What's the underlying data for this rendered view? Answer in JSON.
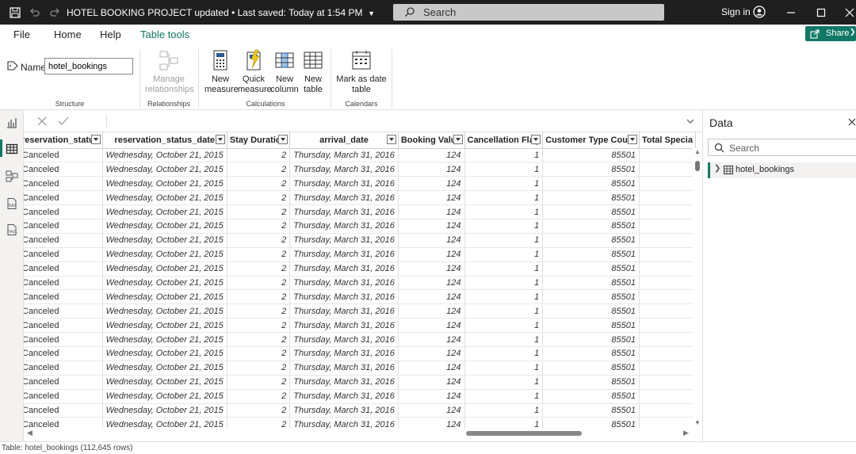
{
  "titlebar": {
    "title": "HOTEL BOOKING PROJECT updated • Last saved: Today at 1:54 PM",
    "search_placeholder": "Search",
    "sign_in": "Sign in"
  },
  "ribbon": {
    "tabs": [
      {
        "label": "File"
      },
      {
        "label": "Home"
      },
      {
        "label": "Help"
      },
      {
        "label": "Table tools",
        "active": true
      }
    ],
    "share": "Share",
    "name_label": "Name",
    "name_value": "hotel_bookings",
    "buttons": {
      "manage_relationships": "Manage relationships",
      "new_measure": "New measure",
      "quick_measure": "Quick measure",
      "new_column": "New column",
      "new_table": "New table",
      "mark_as_date_table": "Mark as date table"
    },
    "groups": {
      "structure": "Structure",
      "relationships": "Relationships",
      "calculations": "Calculations",
      "calendars": "Calendars"
    }
  },
  "table": {
    "columns": [
      "reservation_status",
      "reservation_status_date",
      "Stay Duration",
      "arrival_date",
      "Booking Value",
      "Cancellation Flag",
      "Customer Type Count",
      "Total Specia"
    ],
    "rows": [
      [
        "Canceled",
        "Wednesday, October 21, 2015",
        "2",
        "Thursday, March 31, 2016",
        "124",
        "1",
        "85501",
        ""
      ],
      [
        "Canceled",
        "Wednesday, October 21, 2015",
        "2",
        "Thursday, March 31, 2016",
        "124",
        "1",
        "85501",
        ""
      ],
      [
        "Canceled",
        "Wednesday, October 21, 2015",
        "2",
        "Thursday, March 31, 2016",
        "124",
        "1",
        "85501",
        ""
      ],
      [
        "Canceled",
        "Wednesday, October 21, 2015",
        "2",
        "Thursday, March 31, 2016",
        "124",
        "1",
        "85501",
        ""
      ],
      [
        "Canceled",
        "Wednesday, October 21, 2015",
        "2",
        "Thursday, March 31, 2016",
        "124",
        "1",
        "85501",
        ""
      ],
      [
        "Canceled",
        "Wednesday, October 21, 2015",
        "2",
        "Thursday, March 31, 2016",
        "124",
        "1",
        "85501",
        ""
      ],
      [
        "Canceled",
        "Wednesday, October 21, 2015",
        "2",
        "Thursday, March 31, 2016",
        "124",
        "1",
        "85501",
        ""
      ],
      [
        "Canceled",
        "Wednesday, October 21, 2015",
        "2",
        "Thursday, March 31, 2016",
        "124",
        "1",
        "85501",
        ""
      ],
      [
        "Canceled",
        "Wednesday, October 21, 2015",
        "2",
        "Thursday, March 31, 2016",
        "124",
        "1",
        "85501",
        ""
      ],
      [
        "Canceled",
        "Wednesday, October 21, 2015",
        "2",
        "Thursday, March 31, 2016",
        "124",
        "1",
        "85501",
        ""
      ],
      [
        "Canceled",
        "Wednesday, October 21, 2015",
        "2",
        "Thursday, March 31, 2016",
        "124",
        "1",
        "85501",
        ""
      ],
      [
        "Canceled",
        "Wednesday, October 21, 2015",
        "2",
        "Thursday, March 31, 2016",
        "124",
        "1",
        "85501",
        ""
      ],
      [
        "Canceled",
        "Wednesday, October 21, 2015",
        "2",
        "Thursday, March 31, 2016",
        "124",
        "1",
        "85501",
        ""
      ],
      [
        "Canceled",
        "Wednesday, October 21, 2015",
        "2",
        "Thursday, March 31, 2016",
        "124",
        "1",
        "85501",
        ""
      ],
      [
        "Canceled",
        "Wednesday, October 21, 2015",
        "2",
        "Thursday, March 31, 2016",
        "124",
        "1",
        "85501",
        ""
      ],
      [
        "Canceled",
        "Wednesday, October 21, 2015",
        "2",
        "Thursday, March 31, 2016",
        "124",
        "1",
        "85501",
        ""
      ],
      [
        "Canceled",
        "Wednesday, October 21, 2015",
        "2",
        "Thursday, March 31, 2016",
        "124",
        "1",
        "85501",
        ""
      ],
      [
        "Canceled",
        "Wednesday, October 21, 2015",
        "2",
        "Thursday, March 31, 2016",
        "124",
        "1",
        "85501",
        ""
      ],
      [
        "Canceled",
        "Wednesday, October 21, 2015",
        "2",
        "Thursday, March 31, 2016",
        "124",
        "1",
        "85501",
        ""
      ],
      [
        "Canceled",
        "Wednesday, October 21, 2015",
        "2",
        "Thursday, March 31, 2016",
        "124",
        "1",
        "85501",
        ""
      ]
    ]
  },
  "data_pane": {
    "title": "Data",
    "search_placeholder": "Search",
    "tables": [
      "hotel_bookings"
    ]
  },
  "status_bar": "Table: hotel_bookings (112,645 rows)",
  "colors": {
    "accent": "#117865",
    "titlebar": "#1f1f1f"
  }
}
